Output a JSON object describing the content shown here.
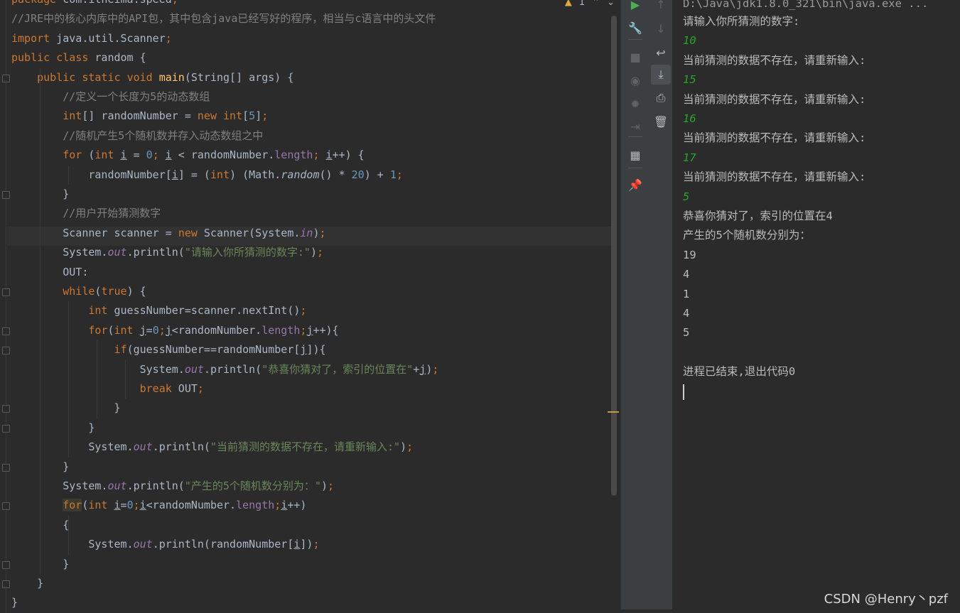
{
  "editor": {
    "problems": {
      "warning_count": "1"
    },
    "lines": [
      "package com.itheima.speed;",
      "//JRE中的核心内库中的API包，其中包含java已经写好的程序，相当与c语言中的头文件",
      "import java.util.Scanner;",
      "public class random {",
      "    public static void main(String[] args) {",
      "        //定义一个长度为5的动态数组",
      "        int[] randomNumber = new int[5];",
      "        //随机产生5个随机数并存入动态数组之中",
      "        for (int i = 0; i < randomNumber.length; i++) {",
      "            randomNumber[i] = (int) (Math.random() * 20) + 1;",
      "        }",
      "        //用户开始猜测数字",
      "        Scanner scanner = new Scanner(System.in);",
      "        System.out.println(\"请输入你所猜测的数字:\");",
      "        OUT:",
      "        while(true) {",
      "            int guessNumber=scanner.nextInt();",
      "            for(int j=0;j<randomNumber.length;j++){",
      "                if(guessNumber==randomNumber[j]){",
      "                    System.out.println(\"恭喜你猜对了，索引的位置在\"+j);",
      "                    break OUT;",
      "                }",
      "            }",
      "            System.out.println(\"当前猜测的数据不存在，请重新输入:\");",
      "        }",
      "        System.out.println(\"产生的5个随机数分别为：\");",
      "        for(int i=0;i<randomNumber.length;i++)",
      "        {",
      "            System.out.println(randomNumber[i]);",
      "        }",
      "    }",
      "}"
    ]
  },
  "console": {
    "path": "D:\\Java\\jdk1.8.0_321\\bin\\java.exe ...",
    "lines": [
      {
        "text": "请输入你所猜测的数字:",
        "input": false
      },
      {
        "text": "10",
        "input": true
      },
      {
        "text": "当前猜测的数据不存在，请重新输入:",
        "input": false
      },
      {
        "text": "15",
        "input": true
      },
      {
        "text": "当前猜测的数据不存在，请重新输入:",
        "input": false
      },
      {
        "text": "16",
        "input": true
      },
      {
        "text": "当前猜测的数据不存在，请重新输入:",
        "input": false
      },
      {
        "text": "17",
        "input": true
      },
      {
        "text": "当前猜测的数据不存在，请重新输入:",
        "input": false
      },
      {
        "text": "5",
        "input": true
      },
      {
        "text": "恭喜你猜对了，索引的位置在4",
        "input": false
      },
      {
        "text": "产生的5个随机数分别为：",
        "input": false
      },
      {
        "text": "19",
        "input": false
      },
      {
        "text": "4",
        "input": false
      },
      {
        "text": "1",
        "input": false
      },
      {
        "text": "4",
        "input": false
      },
      {
        "text": "5",
        "input": false
      },
      {
        "text": "",
        "input": false
      },
      {
        "text": "进程已结束,退出代码0",
        "input": false
      }
    ]
  },
  "watermark": "CSDN @Henry丶pzf",
  "colors": {
    "keyword": "#cc7832",
    "comment": "#808080",
    "string": "#6a8759",
    "number": "#6897bb",
    "field": "#9876aa",
    "input": "#29a329"
  },
  "toolbar": {
    "left_icons": [
      "run-icon",
      "wrench-icon",
      "stop-icon",
      "camera-icon",
      "bug-icon",
      "exit-icon",
      "layout-icon",
      "pin-icon"
    ],
    "right_icons": [
      "up-arrow-icon",
      "down-arrow-icon",
      "soft-wrap-icon",
      "scroll-to-end-icon",
      "print-icon",
      "trash-icon"
    ]
  }
}
